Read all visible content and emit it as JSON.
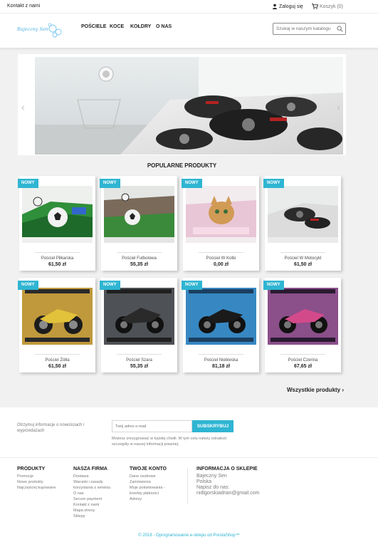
{
  "topbar": {
    "contact": "Kontakt z nami",
    "login": "Zaloguj się",
    "cart": "Koszyk (0)"
  },
  "logo": {
    "text": "Bajeczny Sen"
  },
  "nav": [
    "POŚCIELE",
    "KOCE",
    "KOŁDRY",
    "O NAS"
  ],
  "search": {
    "placeholder": "Szukaj w naszym katalogu"
  },
  "slider": {
    "prev_icon": "chevron-left-icon",
    "next_icon": "chevron-right-icon"
  },
  "popular": {
    "title": "POPULARNE PRODUKTY",
    "badge": "NOWY",
    "products": [
      {
        "name": "Pościel Piłkarska",
        "price": "61,50 zł"
      },
      {
        "name": "Pościel Futbolowa",
        "price": "55,35 zł"
      },
      {
        "name": "Pościel W Kotki",
        "price": "0,00 zł"
      },
      {
        "name": "Pościel W Motocykl",
        "price": "61,50 zł"
      },
      {
        "name": "Pościel Żółta",
        "price": "61,50 zł"
      },
      {
        "name": "Pościel Szara",
        "price": "55,35 zł"
      },
      {
        "name": "Pościel Niebieska",
        "price": "81,18 zł"
      },
      {
        "name": "Pościel Czerina",
        "price": "67,65 zł"
      }
    ],
    "all_products": "Wszystkie produkty"
  },
  "newsletter": {
    "text": "Otrzymuj informacje o nowościach i wyprzedażach",
    "placeholder": "Twój adres e-mail",
    "button": "SUBSKRYBUJ",
    "note": "Możesz zrezygnować w każdej chwili. W tym celu należy odnaleźć szczegóły w naszej informacji prawnej."
  },
  "footer": {
    "col1": {
      "title": "PRODUKTY",
      "links": [
        "Promocje",
        "Nowe produkty",
        "Najczęściej kupowane"
      ]
    },
    "col2": {
      "title": "NASZA FIRMA",
      "links": [
        "Dostawa",
        "Warunki i zasady",
        "korzystania z serwisu",
        "O nas",
        "Secure payment",
        "Kontakt z nami",
        "Mapa strony",
        "Sklepy"
      ]
    },
    "col3": {
      "title": "TWOJE KONTO",
      "links": [
        "Dane osobowe",
        "Zamówienia",
        "Moje pokwitowania -",
        "korekty płatności",
        "Adresy"
      ]
    },
    "store": {
      "title": "INFORMACJA O SKLEPIE",
      "lines": [
        "Bajeczny Sen",
        "Polska",
        "Napisz do nas:",
        "nidtgorskiadrian@gmail.com"
      ]
    },
    "copyright": "© 2018 - Oprogramowanie e-sklepu od PrestaShop™"
  },
  "colors": {
    "accent": "#2fb5d2",
    "text": "#232323",
    "muted": "#7a7a7a",
    "background": "#f1f1f1"
  }
}
